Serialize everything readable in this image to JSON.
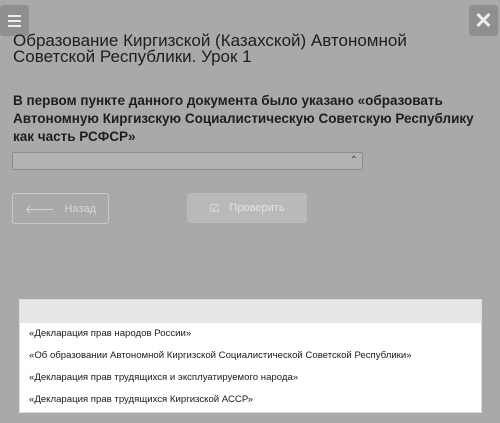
{
  "header": {
    "title": "Образование Киргизской (Казахской) Автономной Советской Республики. Урок 1"
  },
  "question": {
    "text": "В первом пункте данного документа было указано «образовать Автономную Киргизскую Социалистическую Советскую Республику как часть РСФСР»"
  },
  "buttons": {
    "back_label": "Назад",
    "check_label": "Проверить"
  },
  "dropdown": {
    "options": [
      "«Декларация прав народов России»",
      "«Об образовании Автономной Киргизской Социалистической Советской Республики»",
      "«Декларация прав трудящихся и эксплуатируемого народа»",
      "«Декларация прав трудящихся Киргизской АССР»"
    ]
  }
}
